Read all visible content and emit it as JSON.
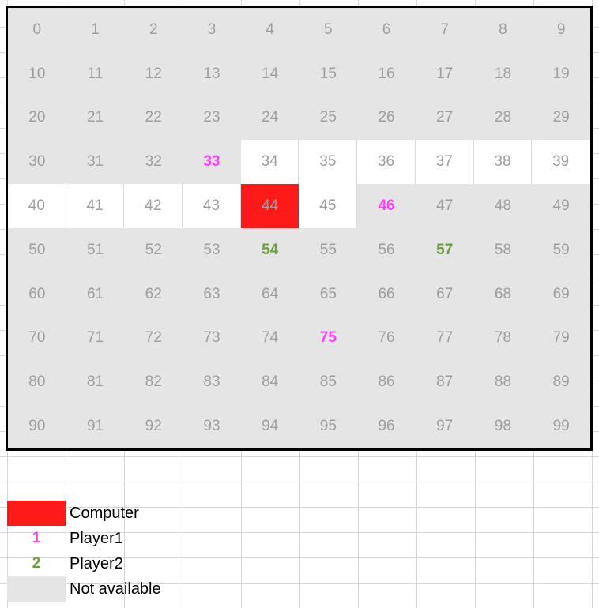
{
  "board": {
    "cells": [
      {
        "n": "0",
        "state": "na"
      },
      {
        "n": "1",
        "state": "na"
      },
      {
        "n": "2",
        "state": "na"
      },
      {
        "n": "3",
        "state": "na"
      },
      {
        "n": "4",
        "state": "na"
      },
      {
        "n": "5",
        "state": "na"
      },
      {
        "n": "6",
        "state": "na"
      },
      {
        "n": "7",
        "state": "na"
      },
      {
        "n": "8",
        "state": "na"
      },
      {
        "n": "9",
        "state": "na"
      },
      {
        "n": "10",
        "state": "na"
      },
      {
        "n": "11",
        "state": "na"
      },
      {
        "n": "12",
        "state": "na"
      },
      {
        "n": "13",
        "state": "na"
      },
      {
        "n": "14",
        "state": "na"
      },
      {
        "n": "15",
        "state": "na"
      },
      {
        "n": "16",
        "state": "na"
      },
      {
        "n": "17",
        "state": "na"
      },
      {
        "n": "18",
        "state": "na"
      },
      {
        "n": "19",
        "state": "na"
      },
      {
        "n": "20",
        "state": "na"
      },
      {
        "n": "21",
        "state": "na"
      },
      {
        "n": "22",
        "state": "na"
      },
      {
        "n": "23",
        "state": "na"
      },
      {
        "n": "24",
        "state": "na"
      },
      {
        "n": "25",
        "state": "na"
      },
      {
        "n": "26",
        "state": "na"
      },
      {
        "n": "27",
        "state": "na"
      },
      {
        "n": "28",
        "state": "na"
      },
      {
        "n": "29",
        "state": "na"
      },
      {
        "n": "30",
        "state": "na"
      },
      {
        "n": "31",
        "state": "na"
      },
      {
        "n": "32",
        "state": "na"
      },
      {
        "n": "33",
        "state": "player1"
      },
      {
        "n": "34",
        "state": "available"
      },
      {
        "n": "35",
        "state": "available"
      },
      {
        "n": "36",
        "state": "available"
      },
      {
        "n": "37",
        "state": "available"
      },
      {
        "n": "38",
        "state": "available"
      },
      {
        "n": "39",
        "state": "available"
      },
      {
        "n": "40",
        "state": "available"
      },
      {
        "n": "41",
        "state": "available"
      },
      {
        "n": "42",
        "state": "available"
      },
      {
        "n": "43",
        "state": "available"
      },
      {
        "n": "44",
        "state": "computer"
      },
      {
        "n": "45",
        "state": "available"
      },
      {
        "n": "46",
        "state": "player1"
      },
      {
        "n": "47",
        "state": "na"
      },
      {
        "n": "48",
        "state": "na"
      },
      {
        "n": "49",
        "state": "na"
      },
      {
        "n": "50",
        "state": "na"
      },
      {
        "n": "51",
        "state": "na"
      },
      {
        "n": "52",
        "state": "na"
      },
      {
        "n": "53",
        "state": "na"
      },
      {
        "n": "54",
        "state": "player2"
      },
      {
        "n": "55",
        "state": "na"
      },
      {
        "n": "56",
        "state": "na"
      },
      {
        "n": "57",
        "state": "player2"
      },
      {
        "n": "58",
        "state": "na"
      },
      {
        "n": "59",
        "state": "na"
      },
      {
        "n": "60",
        "state": "na"
      },
      {
        "n": "61",
        "state": "na"
      },
      {
        "n": "62",
        "state": "na"
      },
      {
        "n": "63",
        "state": "na"
      },
      {
        "n": "64",
        "state": "na"
      },
      {
        "n": "65",
        "state": "na"
      },
      {
        "n": "66",
        "state": "na"
      },
      {
        "n": "67",
        "state": "na"
      },
      {
        "n": "68",
        "state": "na"
      },
      {
        "n": "69",
        "state": "na"
      },
      {
        "n": "70",
        "state": "na"
      },
      {
        "n": "71",
        "state": "na"
      },
      {
        "n": "72",
        "state": "na"
      },
      {
        "n": "73",
        "state": "na"
      },
      {
        "n": "74",
        "state": "na"
      },
      {
        "n": "75",
        "state": "player1"
      },
      {
        "n": "76",
        "state": "na"
      },
      {
        "n": "77",
        "state": "na"
      },
      {
        "n": "78",
        "state": "na"
      },
      {
        "n": "79",
        "state": "na"
      },
      {
        "n": "80",
        "state": "na"
      },
      {
        "n": "81",
        "state": "na"
      },
      {
        "n": "82",
        "state": "na"
      },
      {
        "n": "83",
        "state": "na"
      },
      {
        "n": "84",
        "state": "na"
      },
      {
        "n": "85",
        "state": "na"
      },
      {
        "n": "86",
        "state": "na"
      },
      {
        "n": "87",
        "state": "na"
      },
      {
        "n": "88",
        "state": "na"
      },
      {
        "n": "89",
        "state": "na"
      },
      {
        "n": "90",
        "state": "na"
      },
      {
        "n": "91",
        "state": "na"
      },
      {
        "n": "92",
        "state": "na"
      },
      {
        "n": "93",
        "state": "na"
      },
      {
        "n": "94",
        "state": "na"
      },
      {
        "n": "95",
        "state": "na"
      },
      {
        "n": "96",
        "state": "na"
      },
      {
        "n": "97",
        "state": "na"
      },
      {
        "n": "98",
        "state": "na"
      },
      {
        "n": "99",
        "state": "na"
      }
    ]
  },
  "legend": {
    "computer": {
      "symbol": "",
      "label": "Computer"
    },
    "player1": {
      "symbol": "1",
      "label": "Player1"
    },
    "player2": {
      "symbol": "2",
      "label": "Player2"
    },
    "not_available": {
      "symbol": "",
      "label": "Not available"
    }
  },
  "colors": {
    "computer": "#ff1a1a",
    "player1": "#ff40ff",
    "player2": "#6aa13a",
    "not_available": "#e5e5e5",
    "available": "#ffffff",
    "number_text": "#9e9e9e"
  }
}
